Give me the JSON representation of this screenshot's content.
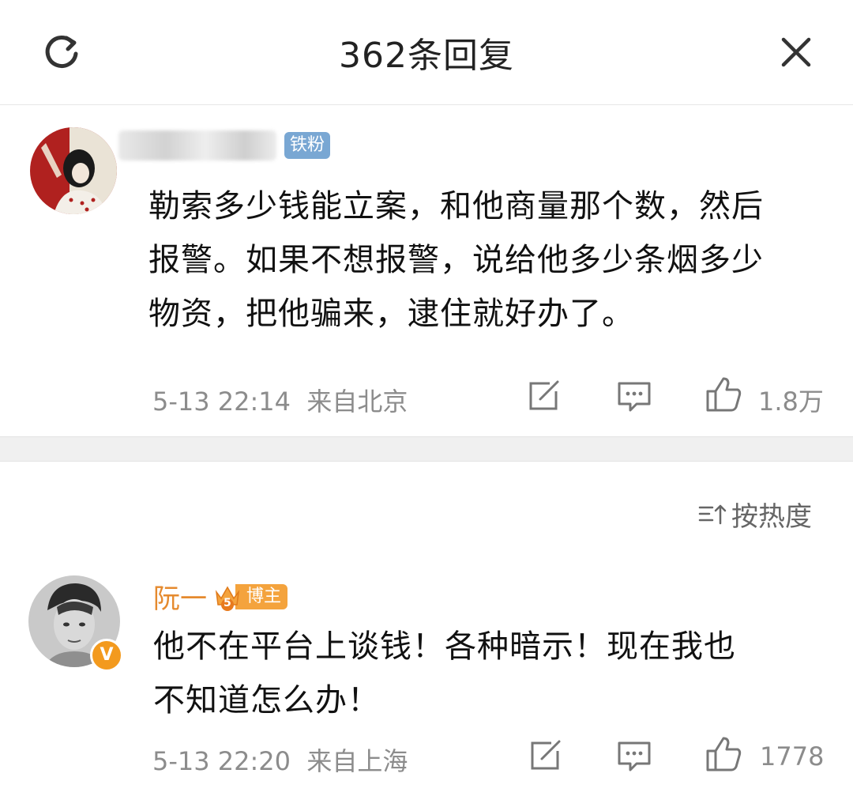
{
  "header": {
    "title": "362条回复"
  },
  "comments": [
    {
      "badge": "铁粉",
      "text_lines": [
        "勒索多少钱能立案，和他商量那个数，然后",
        "报警。如果不想报警，说给他多少条烟多少",
        "物资，把他骗来，逮住就好办了。"
      ],
      "meta": "5-13 22:14  来自北京",
      "likes": "1.8万"
    },
    {
      "username": "阮一",
      "badge": "博主",
      "level": "5",
      "verified_mark": "V",
      "text_lines": [
        "他不在平台上谈钱！各种暗示！现在我也",
        "不知道怎么办！"
      ],
      "meta": "5-13 22:20  来自上海",
      "likes": "1778"
    }
  ],
  "sort": {
    "label": "按热度"
  },
  "colors": {
    "username_accent": "#e58a2e",
    "fan_badge": "#79a7d3",
    "blogger_badge": "#f4a33d",
    "verified": "#f39a1e"
  },
  "icons": [
    "refresh-icon",
    "close-icon",
    "repost-icon",
    "comment-icon",
    "like-icon",
    "sort-icon",
    "crown-icon"
  ]
}
